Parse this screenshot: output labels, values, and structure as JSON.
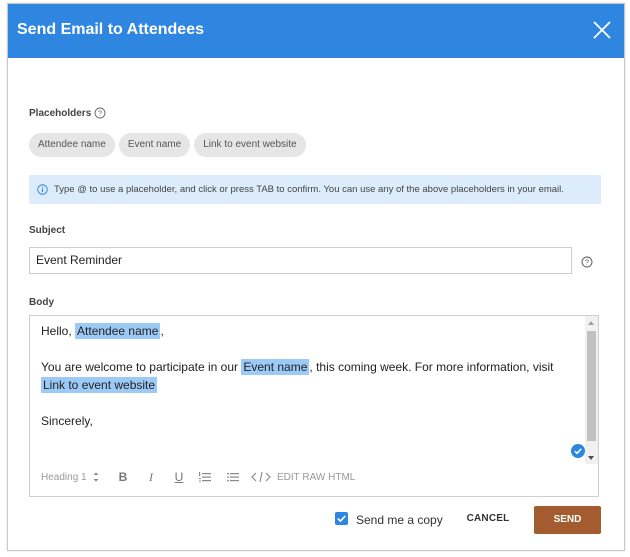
{
  "dialog": {
    "title": "Send Email to Attendees"
  },
  "placeholders": {
    "label": "Placeholders",
    "chips": [
      "Attendee name",
      "Event name",
      "Link to event website"
    ]
  },
  "info": {
    "text": "Type @ to use a placeholder, and click or press TAB to confirm. You can use any of the above placeholders in your email."
  },
  "subject": {
    "label": "Subject",
    "value": "Event Reminder"
  },
  "body": {
    "label": "Body",
    "greeting_prefix": "Hello,",
    "greeting_placeholder": "Attendee name",
    "greeting_suffix": ",",
    "line2_prefix": "You are welcome to participate in our",
    "line2_placeholder": "Event name",
    "line2_suffix": ", this coming week. For more information, visit",
    "line3_placeholder": "Link to event website",
    "closing": "Sincerely,"
  },
  "toolbar": {
    "heading": "Heading 1",
    "bold": "B",
    "italic": "I",
    "underline": "U",
    "raw_html": "EDIT RAW HTML"
  },
  "footer": {
    "send_copy_label": "Send me a copy",
    "send_copy_checked": true,
    "cancel_label": "CANCEL",
    "send_label": "SEND"
  },
  "colors": {
    "header": "#2f86e0",
    "placeholder_highlight": "#9ccaf7",
    "info_bg": "#dcecfb",
    "send_button": "#a25c2f"
  }
}
